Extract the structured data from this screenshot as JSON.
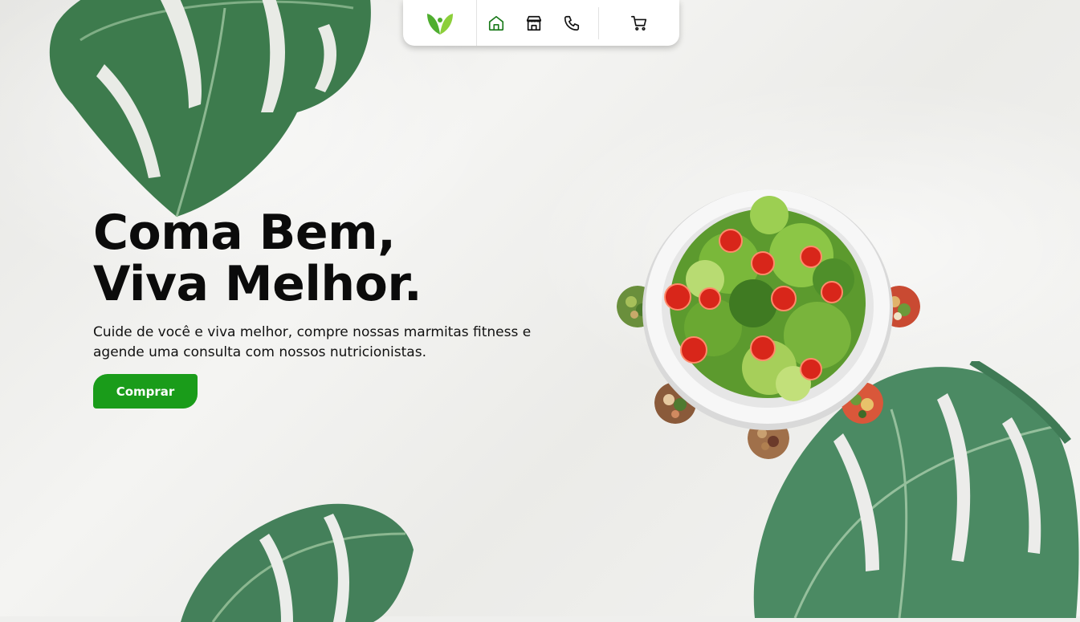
{
  "nav": {
    "logo": "leaf-logo",
    "links": [
      {
        "icon": "home-icon",
        "active": true
      },
      {
        "icon": "store-icon",
        "active": false
      },
      {
        "icon": "phone-icon",
        "active": false
      }
    ],
    "cart_icon": "cart-icon"
  },
  "hero": {
    "title": "Coma Bem,\nViva Melhor.",
    "subtitle": "Cuide de você e viva melhor, compre nossas marmitas fitness e agende uma consulta com nossos nutricionistas.",
    "cta_label": "Comprar"
  },
  "colors": {
    "brand_green": "#1a9c1a",
    "nav_icon_active": "#1a7a1a",
    "text_dark": "#0b0b0b"
  }
}
